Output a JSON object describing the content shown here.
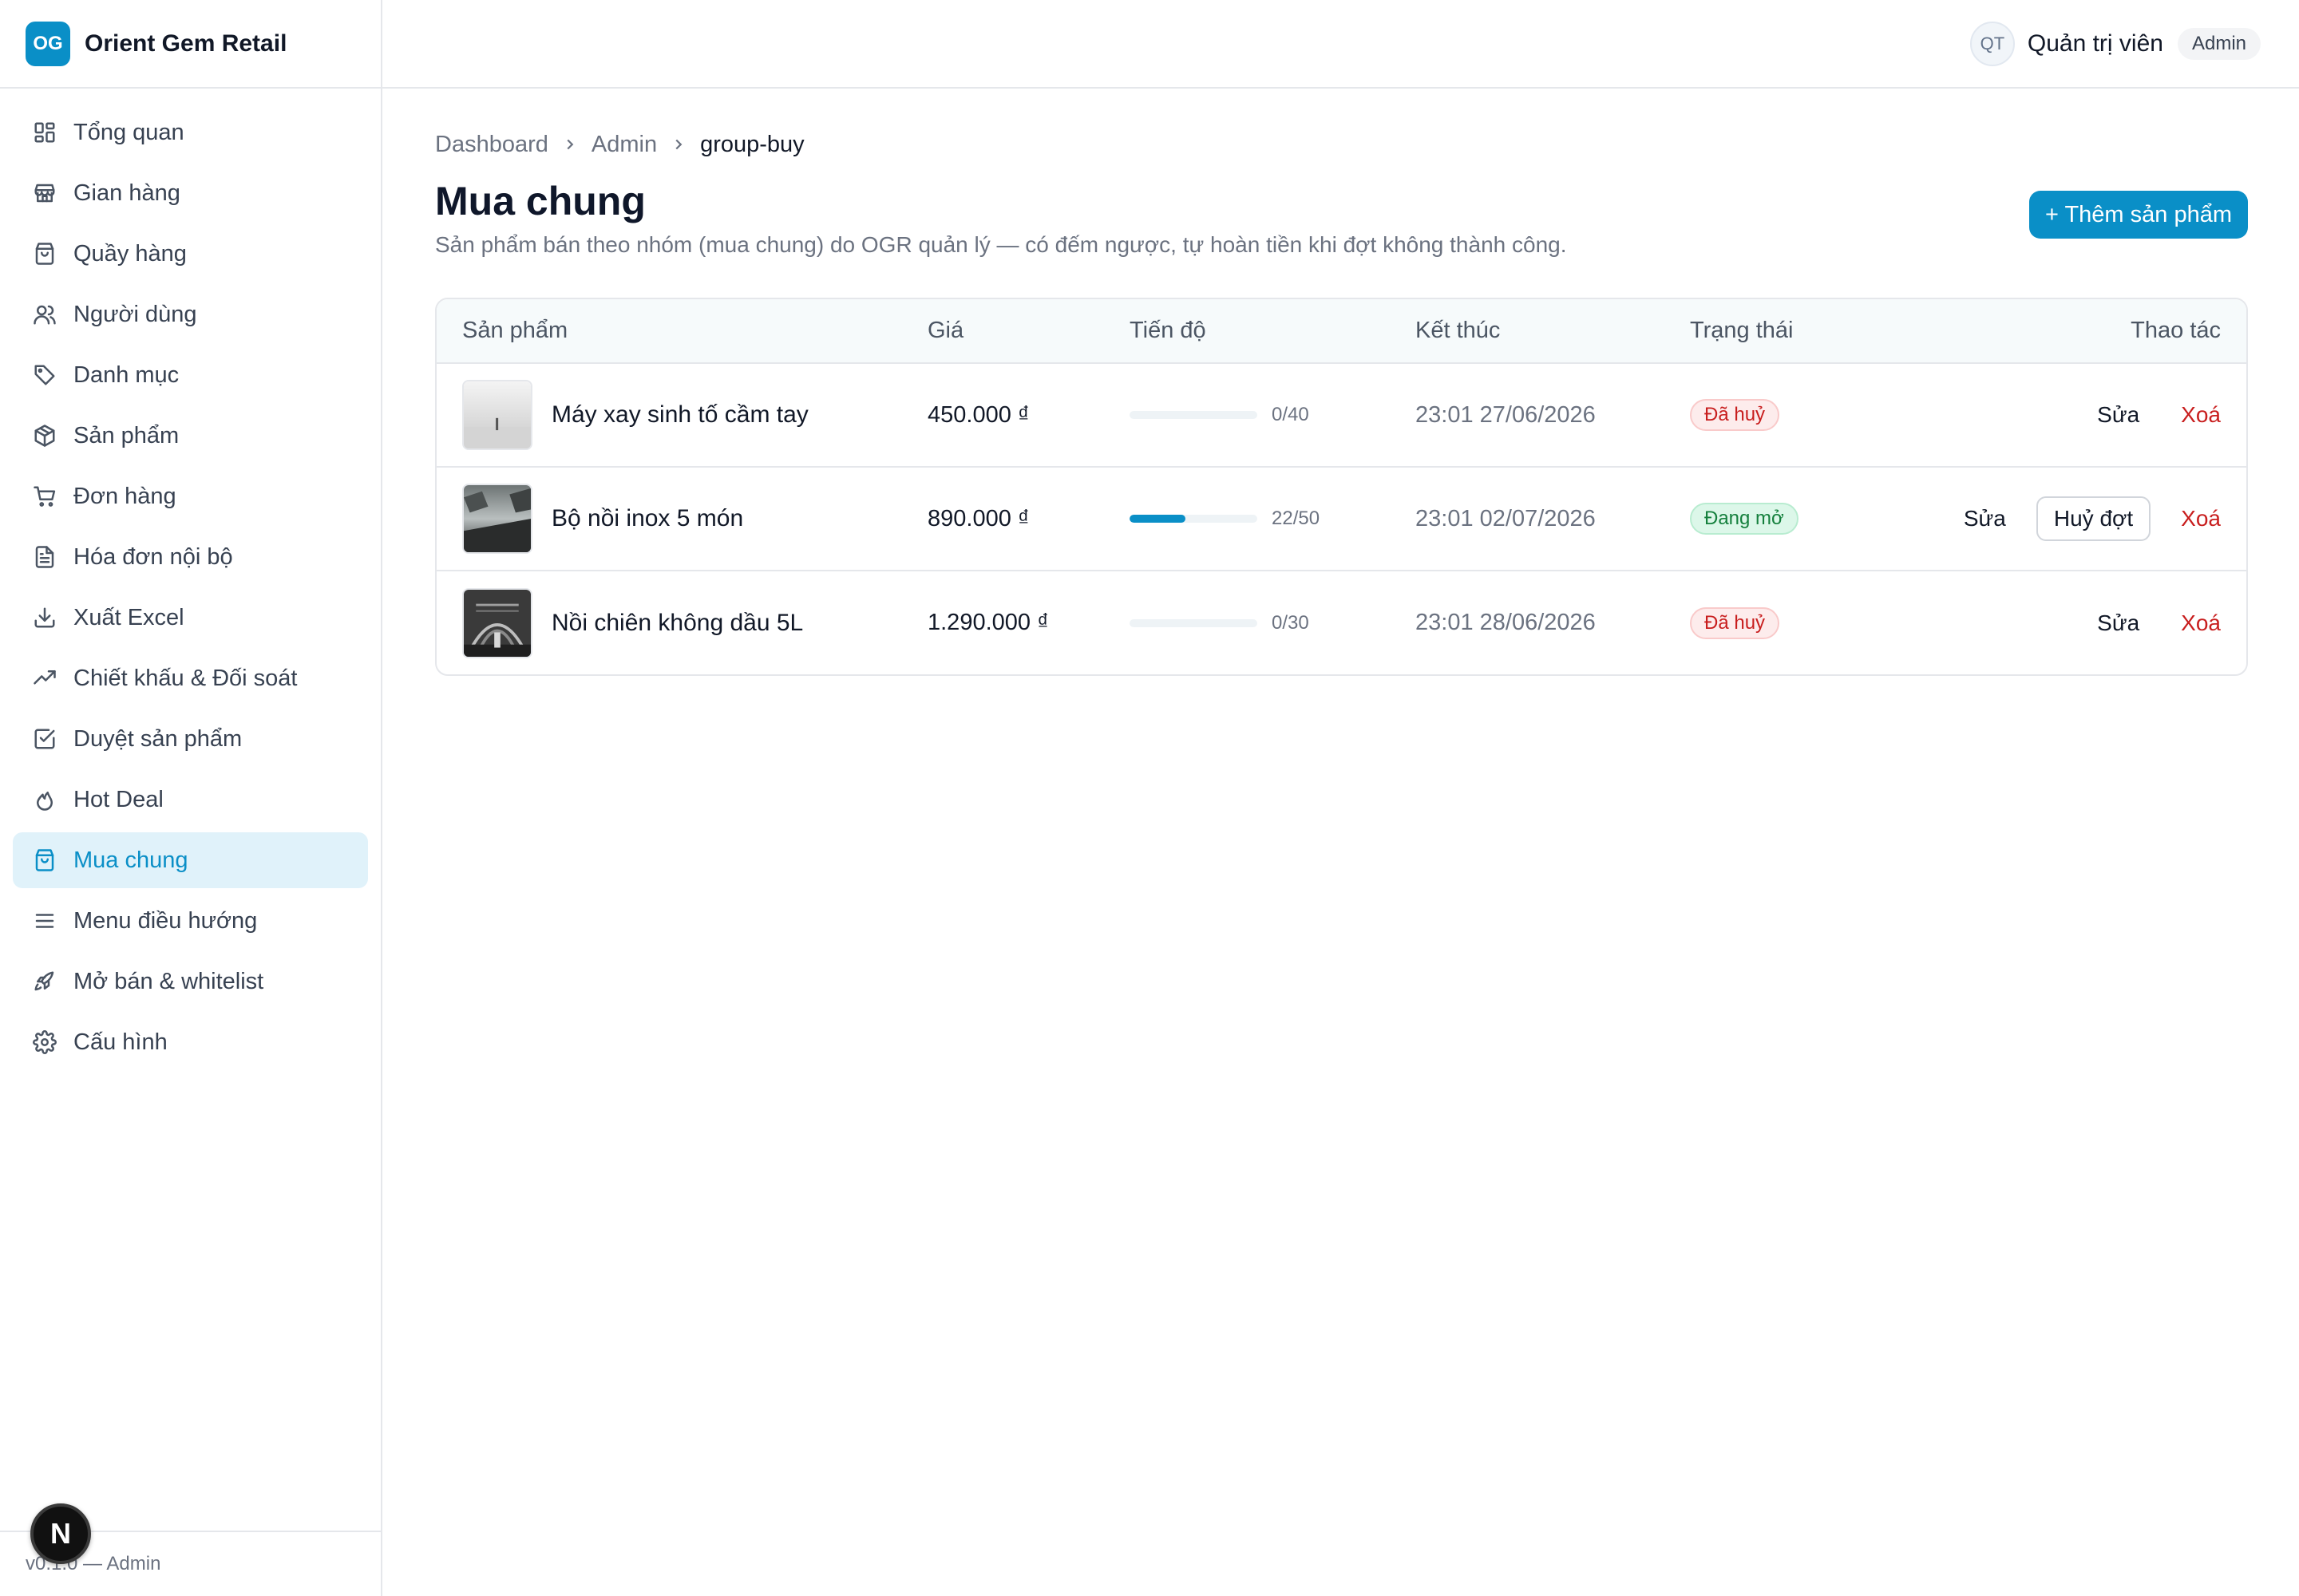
{
  "brand": {
    "logo_text": "OG",
    "name": "Orient Gem Retail",
    "accent": "#0a8fc7"
  },
  "header": {
    "avatar_initials": "QT",
    "user_name": "Quản trị viên",
    "role": "Admin"
  },
  "sidebar": {
    "items": [
      {
        "label": "Tổng quan",
        "icon": "dashboard-icon"
      },
      {
        "label": "Gian hàng",
        "icon": "store-icon"
      },
      {
        "label": "Quầy hàng",
        "icon": "bag-icon"
      },
      {
        "label": "Người dùng",
        "icon": "users-icon"
      },
      {
        "label": "Danh mục",
        "icon": "tag-icon"
      },
      {
        "label": "Sản phẩm",
        "icon": "package-icon"
      },
      {
        "label": "Đơn hàng",
        "icon": "cart-icon"
      },
      {
        "label": "Hóa đơn nội bộ",
        "icon": "file-icon"
      },
      {
        "label": "Xuất Excel",
        "icon": "download-icon"
      },
      {
        "label": "Chiết khấu & Đối soát",
        "icon": "trending-icon"
      },
      {
        "label": "Duyệt sản phẩm",
        "icon": "check-square-icon"
      },
      {
        "label": "Hot Deal",
        "icon": "flame-icon"
      },
      {
        "label": "Mua chung",
        "icon": "shopping-bag-icon",
        "active": true
      },
      {
        "label": "Menu điều hướng",
        "icon": "menu-icon"
      },
      {
        "label": "Mở bán & whitelist",
        "icon": "rocket-icon"
      },
      {
        "label": "Cấu hình",
        "icon": "gear-icon"
      }
    ],
    "footer": "v0.1.0 — Admin",
    "next_badge": "N"
  },
  "breadcrumb": {
    "items": [
      "Dashboard",
      "Admin"
    ],
    "current": "group-buy"
  },
  "page": {
    "title": "Mua chung",
    "subtitle": "Sản phẩm bán theo nhóm (mua chung) do OGR quản lý — có đếm ngược, tự hoàn tiền khi đợt không thành công.",
    "add_button": "+ Thêm sản phẩm"
  },
  "table": {
    "headers": {
      "product": "Sản phẩm",
      "price": "Giá",
      "progress": "Tiến độ",
      "end": "Kết thúc",
      "status": "Trạng thái",
      "actions": "Thao tác"
    },
    "rows": [
      {
        "name": "Máy xay sinh tố cầm tay",
        "price": "450.000 ₫",
        "joined": 0,
        "target": 40,
        "progress_text": "0/40",
        "end": "23:01 27/06/2026",
        "status": "Đã huỷ",
        "status_kind": "cancel",
        "edit": "Sửa",
        "cancel_batch": null,
        "delete": "Xoá"
      },
      {
        "name": "Bộ nồi inox 5 món",
        "price": "890.000 ₫",
        "joined": 22,
        "target": 50,
        "progress_text": "22/50",
        "end": "23:01 02/07/2026",
        "status": "Đang mở",
        "status_kind": "open",
        "edit": "Sửa",
        "cancel_batch": "Huỷ đợt",
        "delete": "Xoá"
      },
      {
        "name": "Nồi chiên không dầu 5L",
        "price": "1.290.000 ₫",
        "joined": 0,
        "target": 30,
        "progress_text": "0/30",
        "end": "23:01 28/06/2026",
        "status": "Đã huỷ",
        "status_kind": "cancel",
        "edit": "Sửa",
        "cancel_batch": null,
        "delete": "Xoá"
      }
    ]
  },
  "colors": {
    "accent": "#0a8fc7",
    "danger": "#c81e1e",
    "success": "#15803d"
  }
}
